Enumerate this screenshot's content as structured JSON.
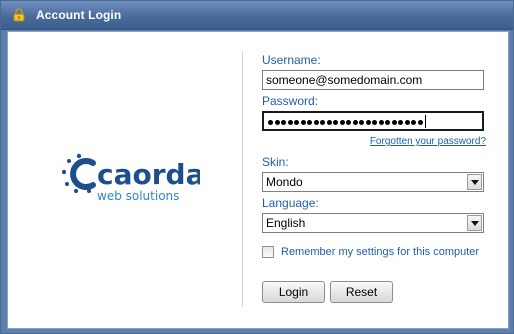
{
  "window": {
    "title": "Account Login"
  },
  "logo": {
    "brand": "caorda",
    "tagline": "web solutions"
  },
  "form": {
    "username_label": "Username:",
    "username_value": "someone@somedomain.com",
    "password_label": "Password:",
    "password_length": 24,
    "forgot_link": "Forgotten your password?",
    "skin_label": "Skin:",
    "skin_value": "Mondo",
    "language_label": "Language:",
    "language_value": "English",
    "remember_label": "Remember my settings for this computer",
    "remember_checked": false,
    "login_button": "Login",
    "reset_button": "Reset"
  },
  "colors": {
    "titlebar": "#47699a",
    "label": "#1f5fa8",
    "logo_blue": "#1d4f8c",
    "logo_light_blue": "#2f86c8"
  },
  "icons": {
    "title": "lock-icon",
    "select": "chevron-down-icon"
  }
}
